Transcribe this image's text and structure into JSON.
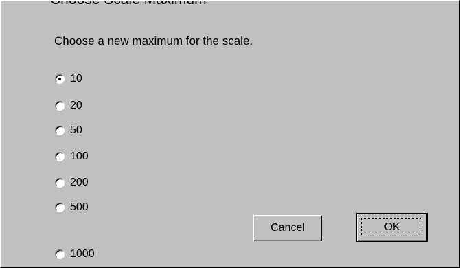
{
  "dialog": {
    "title": "Choose Scale Maximum",
    "prompt": "Choose a new maximum for the scale.",
    "options": [
      {
        "label": "10",
        "checked": true
      },
      {
        "label": "20",
        "checked": false
      },
      {
        "label": "50",
        "checked": false
      },
      {
        "label": "100",
        "checked": false
      },
      {
        "label": "200",
        "checked": false
      },
      {
        "label": "500",
        "checked": false
      },
      {
        "label": "1000",
        "checked": false
      }
    ],
    "buttons": {
      "cancel_label": "Cancel",
      "ok_label": "OK"
    }
  },
  "colors": {
    "face": "#c0c0c0",
    "text": "#000000",
    "highlight": "#ffffff",
    "shadow": "#808080"
  }
}
